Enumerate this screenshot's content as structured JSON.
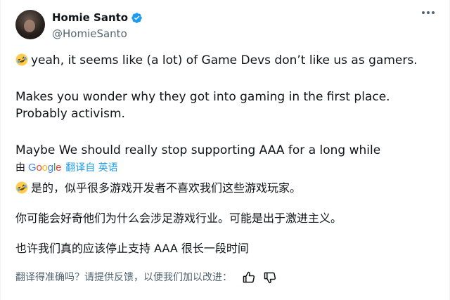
{
  "author": {
    "display_name": "Homie Santo",
    "handle": "@HomieSanto",
    "verified_color": "#1d9bf0"
  },
  "tweet": {
    "line1": "yeah, it seems like (a lot) of Game Devs don’t like us as gamers.",
    "line2": "Makes you wonder why they got into gaming in the first place. Probably activism.",
    "line3": "Maybe We should really stop supporting AAA for a long while"
  },
  "translation": {
    "by_label": "由",
    "provider": "Google",
    "from_label": "翻译自 英语",
    "line1": "是的，似乎很多游戏开发者不喜欢我们这些游戏玩家。",
    "line2": "你可能会好奇他们为什么会涉足游戏行业。可能是出于激进主义。",
    "line3": "也许我们真的应该停止支持 AAA 很长一段时间"
  },
  "feedback": {
    "prompt": "翻译得准确吗？请提供反馈，以便我们加以改进："
  },
  "icons": {
    "emoji": "rofl-emoji-icon",
    "more": "more-options-icon",
    "verified": "verified-badge-icon",
    "thumbs_up": "thumbs-up-icon",
    "thumbs_down": "thumbs-down-icon"
  }
}
